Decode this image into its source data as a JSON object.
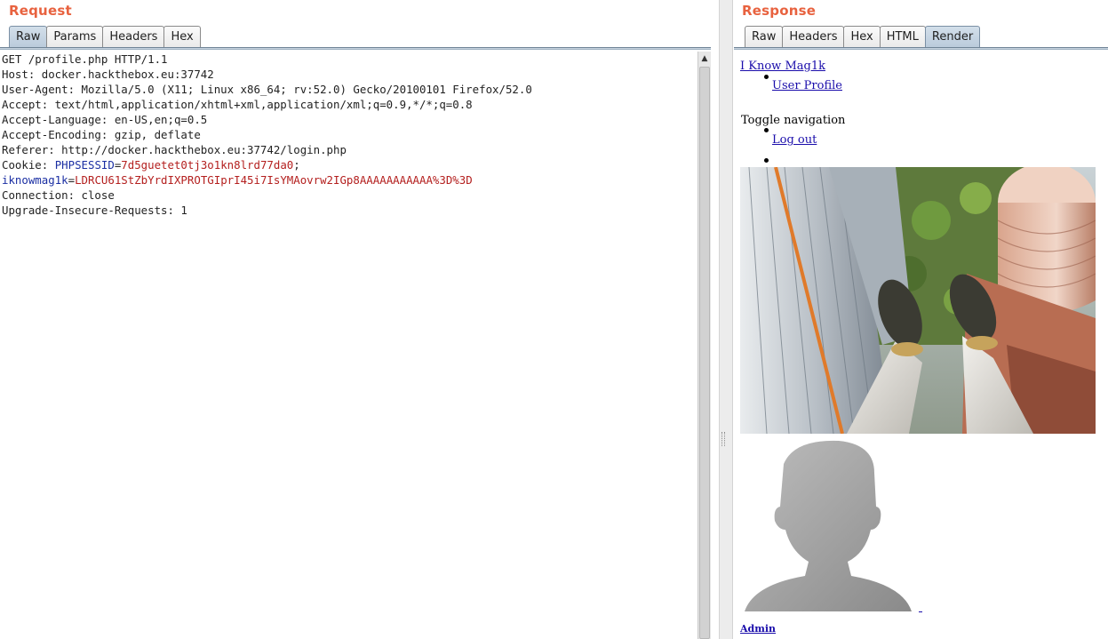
{
  "request": {
    "title": "Request",
    "tabs": [
      "Raw",
      "Params",
      "Headers",
      "Hex"
    ],
    "active_tab": "Raw",
    "lines": [
      "GET /profile.php HTTP/1.1",
      "Host: docker.hackthebox.eu:37742",
      "User-Agent: Mozilla/5.0 (X11; Linux x86_64; rv:52.0) Gecko/20100101 Firefox/52.0",
      "Accept: text/html,application/xhtml+xml,application/xml;q=0.9,*/*;q=0.8",
      "Accept-Language: en-US,en;q=0.5",
      "Accept-Encoding: gzip, deflate",
      "Referer: http://docker.hackthebox.eu:37742/login.php"
    ],
    "cookie": {
      "prefix": "Cookie: ",
      "name1": "PHPSESSID",
      "eq1": "=",
      "value1": "7d5guetet0tj3o1kn8lrd77da0",
      "sep": ";",
      "name2": "iknowmag1k",
      "eq2": "=",
      "value2": "LDRCU61StZbYrdIXPROTGIprI45i7IsYMAovrw2IGp8AAAAAAAAAAA%3D%3D"
    },
    "lines_after": [
      "Connection: close",
      "Upgrade-Insecure-Requests: 1"
    ]
  },
  "response": {
    "title": "Response",
    "tabs": [
      "Raw",
      "Headers",
      "Hex",
      "HTML",
      "Render"
    ],
    "active_tab": "Render",
    "render": {
      "brand_link": "I Know Mag1k",
      "user_profile_link": "User Profile",
      "toggle_navigation": "Toggle navigation",
      "logout_link": "Log out",
      "admin_link": "Admin"
    }
  },
  "colors": {
    "pane_title": "#e8623f",
    "active_tab": "#c6d3df",
    "cookie_name": "#1b2fa3",
    "cookie_value": "#b4201f",
    "link": "#1a0dab"
  }
}
